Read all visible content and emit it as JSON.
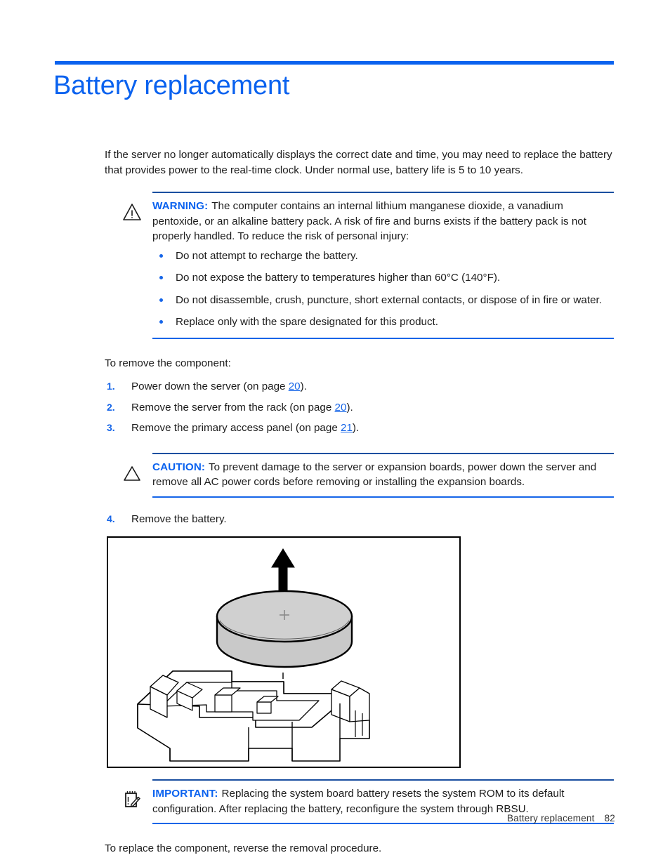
{
  "document": {
    "title": "Battery replacement",
    "intro": "If the server no longer automatically displays the correct date and time, you may need to replace the battery that provides power to the real-time clock. Under normal use, battery life is 5 to 10 years.",
    "remove_intro": "To remove the component:",
    "closing": "To replace the component, reverse the removal procedure."
  },
  "warning": {
    "icon": "warning-triangle-icon",
    "label": "WARNING:",
    "text": "The computer contains an internal lithium manganese dioxide, a vanadium pentoxide, or an alkaline battery pack. A risk of fire and burns exists if the battery pack is not properly handled. To reduce the risk of personal injury:",
    "bullets": [
      "Do not attempt to recharge the battery.",
      "Do not expose the battery to temperatures higher than 60°C (140°F).",
      "Do not disassemble, crush, puncture, short external contacts, or dispose of in fire or water.",
      "Replace only with the spare designated for this product."
    ]
  },
  "caution": {
    "icon": "caution-triangle-icon",
    "label": "CAUTION:",
    "text": "To prevent damage to the server or expansion boards, power down the server and remove all AC power cords before removing or installing the expansion boards."
  },
  "important": {
    "icon": "important-notepad-icon",
    "label": "IMPORTANT:",
    "text": "Replacing the system board battery resets the system ROM to its default configuration. After replacing the battery, reconfigure the system through RBSU."
  },
  "steps": [
    {
      "num": "1.",
      "pre": "Power down the server (on page ",
      "link": "20",
      "post": ")."
    },
    {
      "num": "2.",
      "pre": "Remove the server from the rack (on page ",
      "link": "20",
      "post": ")."
    },
    {
      "num": "3.",
      "pre": "Remove the primary access panel (on page ",
      "link": "21",
      "post": ")."
    },
    {
      "num": "4.",
      "pre": "Remove the battery.",
      "link": "",
      "post": ""
    }
  ],
  "figure": {
    "name": "battery-removal-illustration",
    "description": "Coin cell battery being lifted upward out of its system board socket",
    "battery_marking": "+",
    "arrow_direction": "up"
  },
  "footer": {
    "section": "Battery replacement",
    "page_number": "82"
  },
  "colors": {
    "accent_blue": "#0a62ef",
    "rule_blue": "#1565e8",
    "rule_dark_blue": "#1a4fa0",
    "text": "#1c1c1c",
    "battery_gray": "#c9c9c9"
  }
}
